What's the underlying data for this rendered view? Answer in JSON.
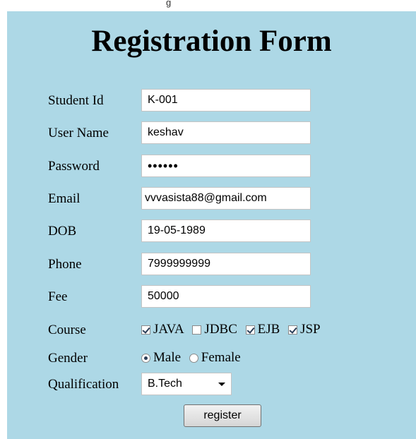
{
  "header_fragment": "g",
  "title": "Registration Form",
  "fields": {
    "student_id": {
      "label": "Student Id",
      "value": "K-001"
    },
    "user_name": {
      "label": "User Name",
      "value": "keshav"
    },
    "password": {
      "label": "Password",
      "value": "••••••"
    },
    "email": {
      "label": "Email",
      "value": "vvvasista88@gmail.com"
    },
    "dob": {
      "label": "DOB",
      "value": "19-05-1989"
    },
    "phone": {
      "label": "Phone",
      "value": "7999999999"
    },
    "fee": {
      "label": "Fee",
      "value": "50000"
    }
  },
  "course": {
    "label": "Course",
    "options": [
      {
        "label": "JAVA",
        "checked": true
      },
      {
        "label": "JDBC",
        "checked": false
      },
      {
        "label": "EJB",
        "checked": true
      },
      {
        "label": "JSP",
        "checked": true
      }
    ]
  },
  "gender": {
    "label": "Gender",
    "options": [
      {
        "label": "Male",
        "selected": true
      },
      {
        "label": "Female",
        "selected": false
      }
    ]
  },
  "qualification": {
    "label": "Qualification",
    "value": "B.Tech"
  },
  "register_label": "register",
  "colors": {
    "panel_background": "#add8e6",
    "check_mark": "#2a3d57"
  }
}
